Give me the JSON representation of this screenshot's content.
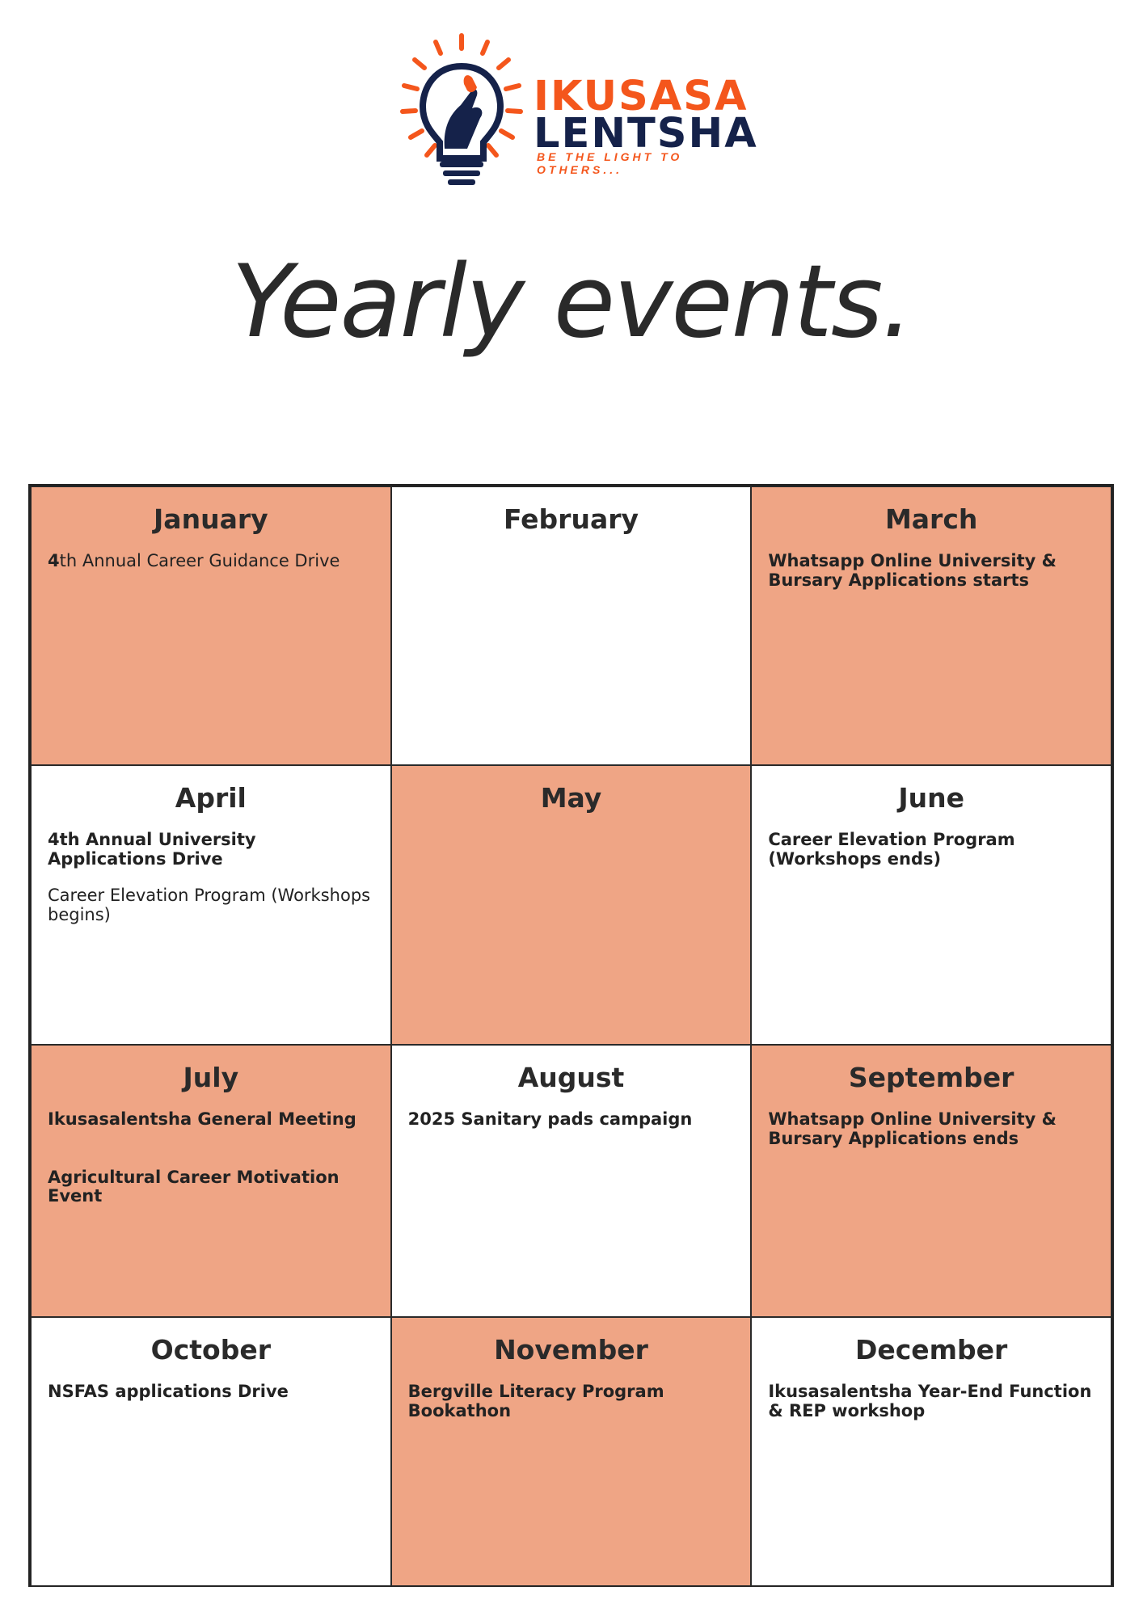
{
  "logo": {
    "brand_line1": "IKUSASA",
    "brand_line2": "LENTSHA",
    "tagline": "BE THE LIGHT TO OTHERS...",
    "icon": "lightbulb-hand-icon",
    "colors": {
      "orange": "#f4561c",
      "navy": "#15224a"
    }
  },
  "title": "Yearly events.",
  "colors": {
    "cell_orange": "#efa585",
    "cell_white": "#ffffff",
    "grid_line": "#2a2a2a"
  },
  "months": [
    {
      "name": "January",
      "events": [
        {
          "prefix": "4",
          "text": "th Annual Career Guidance Drive"
        }
      ]
    },
    {
      "name": "February",
      "events": []
    },
    {
      "name": "March",
      "events": [
        {
          "text": "Whatsapp Online University & Bursary Applications starts"
        }
      ]
    },
    {
      "name": "April",
      "events": [
        {
          "text": "4th Annual University Applications Drive"
        },
        {
          "text": "Career Elevation Program (Workshops begins)"
        }
      ]
    },
    {
      "name": "May",
      "events": []
    },
    {
      "name": "June",
      "events": [
        {
          "text": "Career Elevation Program (Workshops ends)"
        }
      ]
    },
    {
      "name": "July",
      "events": [
        {
          "text": "Ikusasalentsha General Meeting"
        },
        {
          "text": "Agricultural Career Motivation Event"
        }
      ]
    },
    {
      "name": "August",
      "events": [
        {
          "text": "2025 Sanitary pads campaign"
        }
      ]
    },
    {
      "name": "September",
      "events": [
        {
          "text": "Whatsapp Online University & Bursary Applications ends"
        }
      ]
    },
    {
      "name": "October",
      "events": [
        {
          "text": "NSFAS applications Drive"
        }
      ]
    },
    {
      "name": "November",
      "events": [
        {
          "text": "Bergville Literacy Program Bookathon"
        }
      ]
    },
    {
      "name": "December",
      "events": [
        {
          "text": "Ikusasalentsha Year-End Function & REP workshop"
        }
      ]
    }
  ]
}
